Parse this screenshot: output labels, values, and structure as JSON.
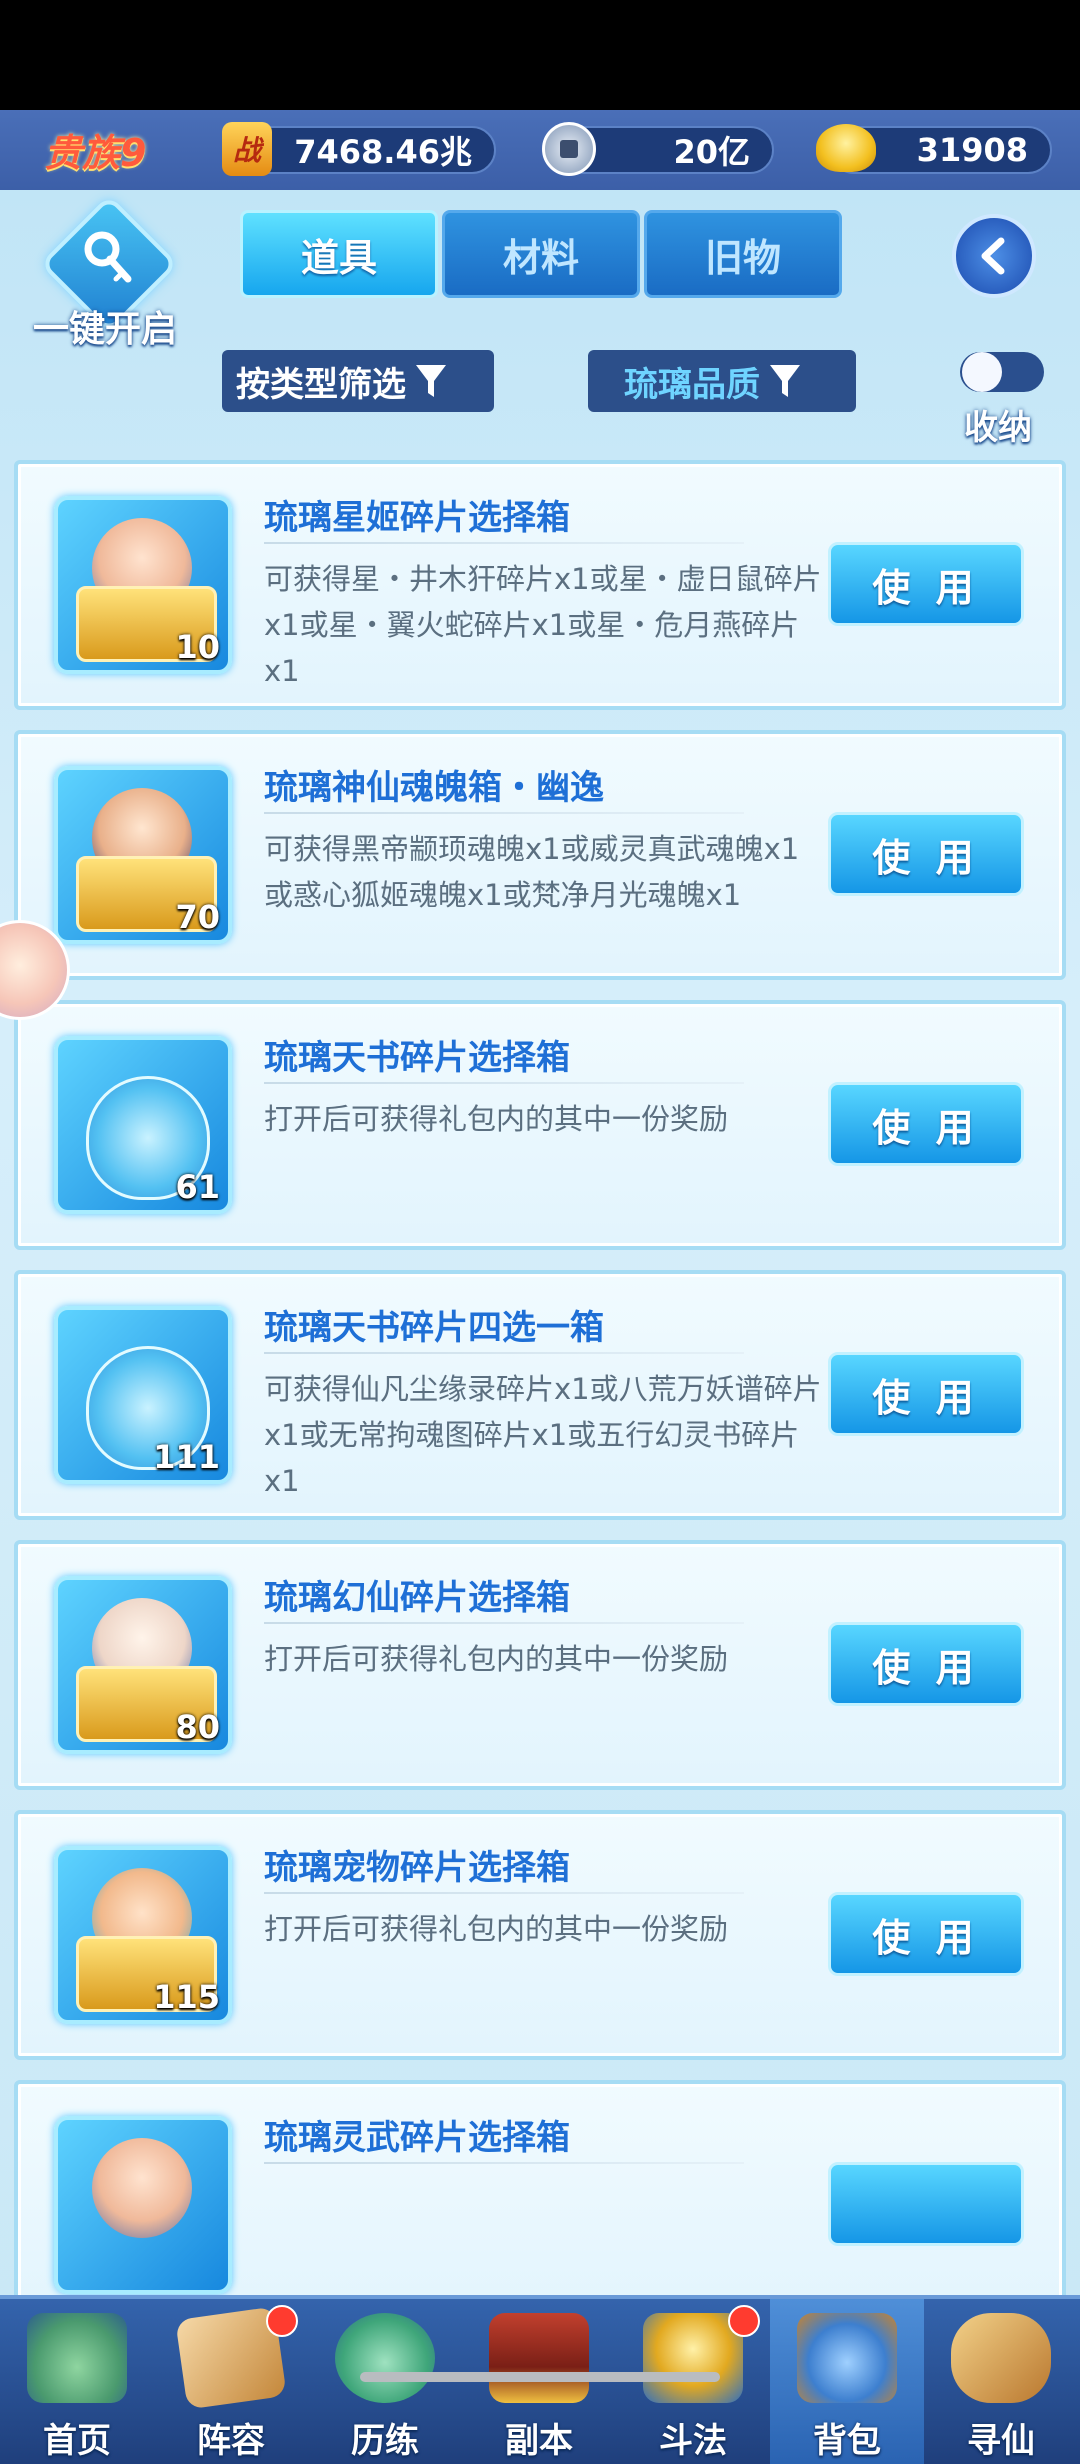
{
  "header": {
    "noble_rank": "贵族9",
    "power_icon_text": "战",
    "power_value": "7468.46兆",
    "coin_value": "20亿",
    "gold_value": "31908"
  },
  "toolbar": {
    "one_key_open_label": "一键开启",
    "tabs": [
      {
        "label": "道具",
        "active": true
      },
      {
        "label": "材料",
        "active": false
      },
      {
        "label": "旧物",
        "active": false
      }
    ],
    "filter_type_label": "按类型筛选",
    "filter_quality_label": "琉璃品质",
    "collect_toggle_label": "收纳",
    "collect_toggle_on": false
  },
  "items": [
    {
      "title": "琉璃星姬碎片选择箱",
      "desc": "可获得星・井木犴碎片x1或星・虚日鼠碎片x1或星・翼火蛇碎片x1或星・危月燕碎片x1",
      "count": "10",
      "use_label": "使 用",
      "icon": "chest-portrait-icon"
    },
    {
      "title": "琉璃神仙魂魄箱・幽逸",
      "desc": "可获得黑帝颛顼魂魄x1或威灵真武魂魄x1或惑心狐姬魂魄x1或梵净月光魂魄x1",
      "count": "70",
      "use_label": "使 用",
      "icon": "chest-portrait-icon"
    },
    {
      "title": "琉璃天书碎片选择箱",
      "desc": "打开后可获得礼包内的其中一份奖励",
      "count": "61",
      "use_label": "使 用",
      "icon": "gift-bag-icon"
    },
    {
      "title": "琉璃天书碎片四选一箱",
      "desc": "可获得仙凡尘缘录碎片x1或八荒万妖谱碎片x1或无常拘魂图碎片x1或五行幻灵书碎片x1",
      "count": "111",
      "use_label": "使 用",
      "icon": "gift-bag-icon"
    },
    {
      "title": "琉璃幻仙碎片选择箱",
      "desc": "打开后可获得礼包内的其中一份奖励",
      "count": "80",
      "use_label": "使 用",
      "icon": "chest-portrait-icon"
    },
    {
      "title": "琉璃宠物碎片选择箱",
      "desc": "打开后可获得礼包内的其中一份奖励",
      "count": "115",
      "use_label": "使 用",
      "icon": "chest-portrait-icon"
    },
    {
      "title": "琉璃灵武碎片选择箱",
      "desc": "",
      "count": "",
      "use_label": "",
      "icon": "chest-portrait-icon"
    }
  ],
  "nav": [
    {
      "label": "首页",
      "icon": "home-island-icon",
      "badge": false,
      "active": false
    },
    {
      "label": "阵容",
      "icon": "cards-icon",
      "badge": true,
      "active": false
    },
    {
      "label": "历练",
      "icon": "gourd-icon",
      "badge": false,
      "active": false
    },
    {
      "label": "副本",
      "icon": "temple-gate-icon",
      "badge": false,
      "active": false
    },
    {
      "label": "斗法",
      "icon": "sword-icon",
      "badge": true,
      "active": false
    },
    {
      "label": "背包",
      "icon": "backpack-icon",
      "badge": false,
      "active": true
    },
    {
      "label": "寻仙",
      "icon": "scroll-icon",
      "badge": false,
      "active": false
    }
  ],
  "colors": {
    "accent": "#1e6fd6",
    "button": "#1596e6",
    "badge": "#ff3b2f"
  }
}
